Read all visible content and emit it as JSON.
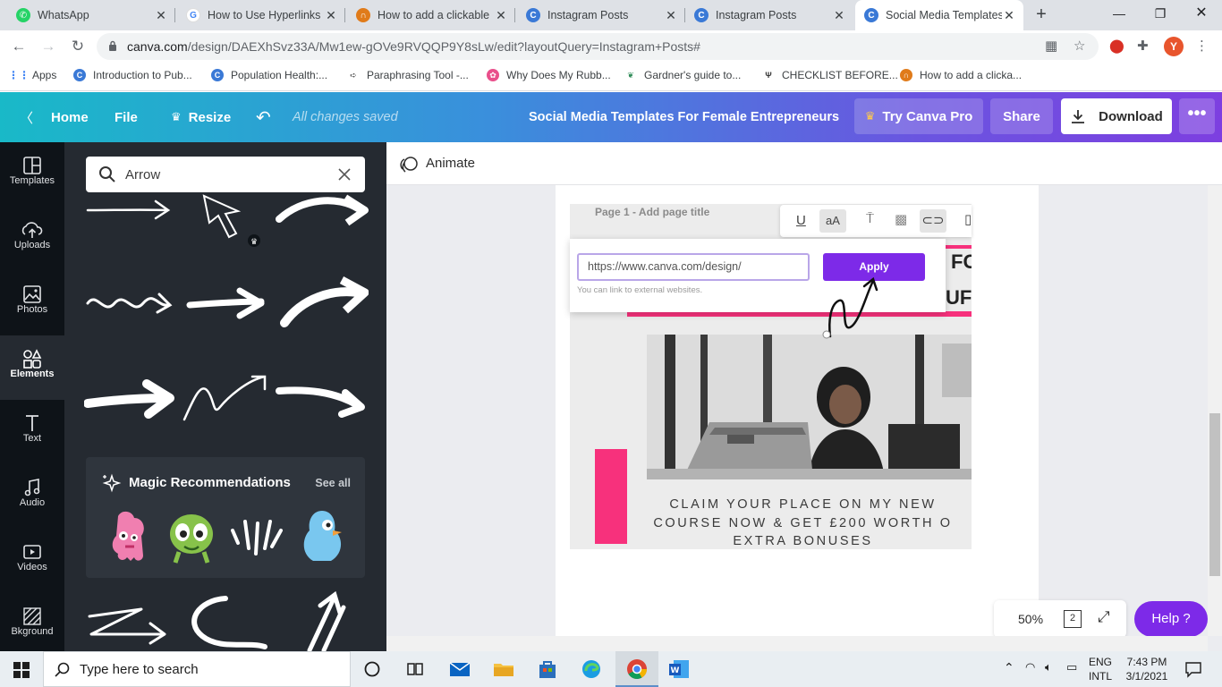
{
  "browser": {
    "tabs": [
      {
        "title": "WhatsApp",
        "color": "#25d366",
        "glyph": "✆"
      },
      {
        "title": "How to Use Hyperlinks",
        "color": "#4285f4",
        "glyph": "G"
      },
      {
        "title": "How to add a clickable",
        "color": "#e07b1a",
        "glyph": "∩"
      },
      {
        "title": "Instagram Posts",
        "color": "#3a79d6",
        "glyph": "C"
      },
      {
        "title": "Instagram Posts",
        "color": "#3a79d6",
        "glyph": "C"
      },
      {
        "title": "Social Media Templates",
        "color": "#3a79d6",
        "glyph": "C"
      }
    ],
    "url_main": "canva.com",
    "url_rest": "/design/DAEXhSvz33A/Mw1ew-gOVe9RVQQP9Y8sLw/edit?layoutQuery=Instagram+Posts#",
    "profile_initial": "Y",
    "bookmarks": [
      {
        "label": "Apps"
      },
      {
        "label": "Introduction to Pub..."
      },
      {
        "label": "Population Health:..."
      },
      {
        "label": "Paraphrasing Tool -..."
      },
      {
        "label": "Why Does My Rubb..."
      },
      {
        "label": "Gardner's guide to..."
      },
      {
        "label": "CHECKLIST BEFORE..."
      },
      {
        "label": "How to add a clicka..."
      }
    ]
  },
  "header": {
    "home": "Home",
    "file": "File",
    "resize": "Resize",
    "saved": "All changes saved",
    "title": "Social Media Templates For Female Entrepreneurs",
    "try_pro": "Try Canva Pro",
    "share": "Share",
    "download": "Download"
  },
  "rail": [
    {
      "label": "Templates",
      "icon": "templates-icon"
    },
    {
      "label": "Uploads",
      "icon": "upload-icon"
    },
    {
      "label": "Photos",
      "icon": "photo-icon"
    },
    {
      "label": "Elements",
      "icon": "shapes-icon"
    },
    {
      "label": "Text",
      "icon": "text-icon"
    },
    {
      "label": "Audio",
      "icon": "music-note-icon"
    },
    {
      "label": "Videos",
      "icon": "video-icon"
    },
    {
      "label": "Bkground",
      "icon": "background-icon"
    }
  ],
  "panel": {
    "search_value": "Arrow",
    "magic_title": "Magic Recommendations",
    "see_all": "See all"
  },
  "canvas": {
    "animate": "Animate",
    "page_title": "Page 1 - Add page title",
    "link_value": "https://www.canva.com/design/",
    "apply": "Apply",
    "hint": "You can link to external websites.",
    "claim_line1": "CLAIM YOUR PLACE ON MY NEW",
    "claim_line2": "COURSE NOW & GET £200 WORTH O",
    "claim_line3": "EXTRA BONUSES",
    "zoom": "50%",
    "pages": "2",
    "help": "Help ?"
  },
  "taskbar": {
    "search_placeholder": "Type here to search",
    "lang1": "ENG",
    "lang2": "INTL",
    "time": "7:43 PM",
    "date": "3/1/2021"
  }
}
